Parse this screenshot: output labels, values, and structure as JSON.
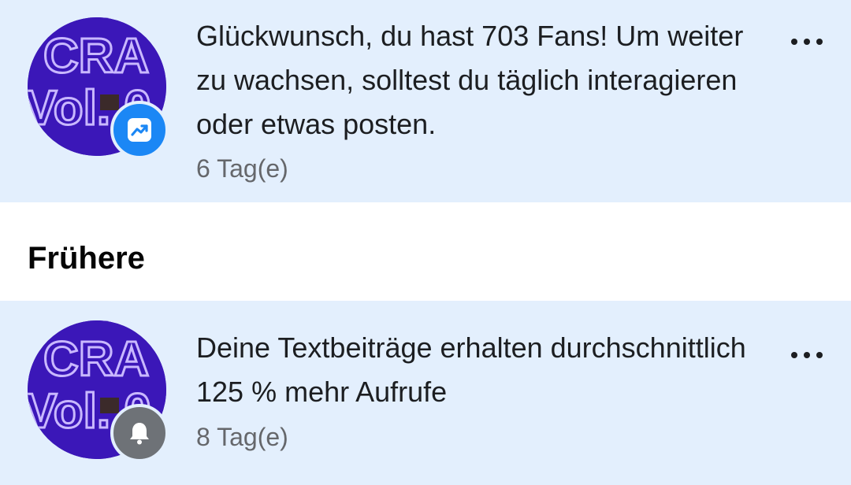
{
  "notifications": [
    {
      "avatar_text": [
        "CRA",
        "Vol. 0"
      ],
      "badge_icon": "trending-up-icon",
      "badge_color": "#1b87f5",
      "text": "Glückwunsch, du hast 703 Fans! Um weiter zu wachsen, solltest du täglich interagieren oder etwas posten.",
      "time": "6 Tag(e)"
    },
    {
      "avatar_text": [
        "CRA",
        "Vol. 0"
      ],
      "badge_icon": "bell-icon",
      "badge_color": "#6e7277",
      "text": "Deine Textbeiträge erhalten durchschnittlich 125 % mehr Aufrufe",
      "time": "8 Tag(e)"
    }
  ],
  "section": {
    "title": "Frühere"
  },
  "colors": {
    "unread_bg": "#e3effd",
    "accent": "#1b87f5"
  }
}
